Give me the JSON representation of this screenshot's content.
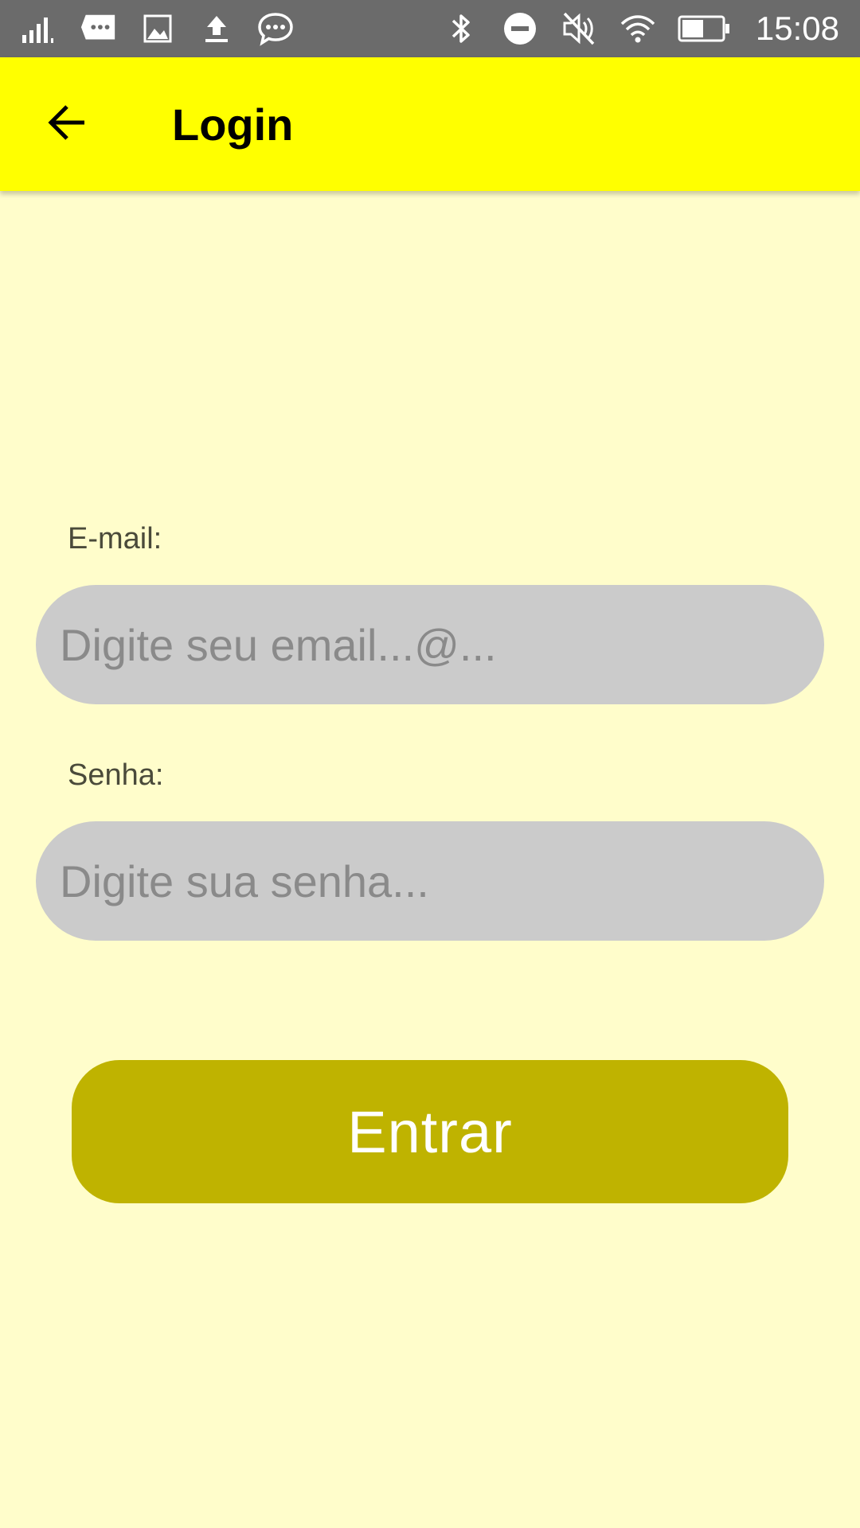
{
  "status_bar": {
    "time": "15:08",
    "icons": [
      "signal-icon",
      "message-icon",
      "image-icon",
      "upload-icon",
      "chat-icon",
      "bluetooth-icon",
      "do-not-disturb-icon",
      "mute-icon",
      "wifi-icon",
      "battery-icon"
    ]
  },
  "app_bar": {
    "title": "Login",
    "back_icon": "arrow-back-icon",
    "background": "#FFFF00"
  },
  "form": {
    "email_label": "E-mail:",
    "email_placeholder": "Digite seu email...@...",
    "email_value": "",
    "password_label": "Senha:",
    "password_placeholder": "Digite sua senha...",
    "password_value": "",
    "submit_label": "Entrar"
  },
  "colors": {
    "page_background": "#FFFDCB",
    "input_background": "#CBCBCB",
    "button_background": "#BFB300"
  }
}
